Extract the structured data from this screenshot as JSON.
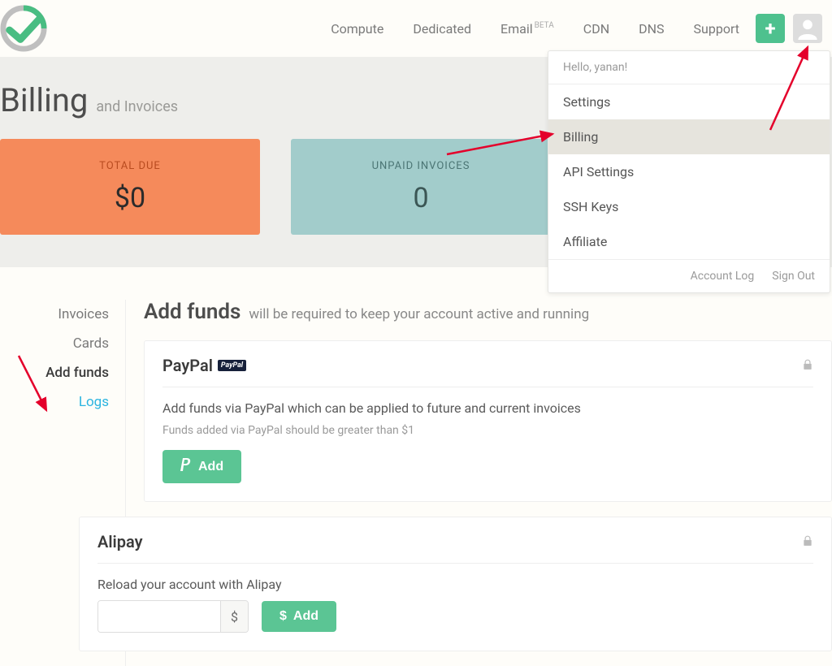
{
  "nav": {
    "links": [
      "Compute",
      "Dedicated",
      "Email",
      "CDN",
      "DNS",
      "Support"
    ],
    "email_badge": "BETA"
  },
  "dropdown": {
    "greeting": "Hello, yanan!",
    "items": [
      "Settings",
      "Billing",
      "API Settings",
      "SSH Keys",
      "Affiliate"
    ],
    "footer": [
      "Account Log",
      "Sign Out"
    ]
  },
  "hero": {
    "title": "Billing",
    "subtitle": "and Invoices",
    "stats": [
      {
        "label": "TOTAL DUE",
        "value": "$0"
      },
      {
        "label": "UNPAID INVOICES",
        "value": "0"
      }
    ]
  },
  "sidebar": {
    "items": [
      "Invoices",
      "Cards",
      "Add funds",
      "Logs"
    ]
  },
  "main": {
    "title": "Add funds",
    "desc": "will be required to keep your account active and running"
  },
  "paypal": {
    "title": "PayPal",
    "badge": "PayPal",
    "desc": "Add funds via PayPal which can be applied to future and current invoices",
    "note": "Funds added via PayPal should be greater than $1",
    "btn": "Add"
  },
  "alipay": {
    "title": "Alipay",
    "desc": "Reload your account with Alipay",
    "currency": "$",
    "btn": "Add"
  }
}
